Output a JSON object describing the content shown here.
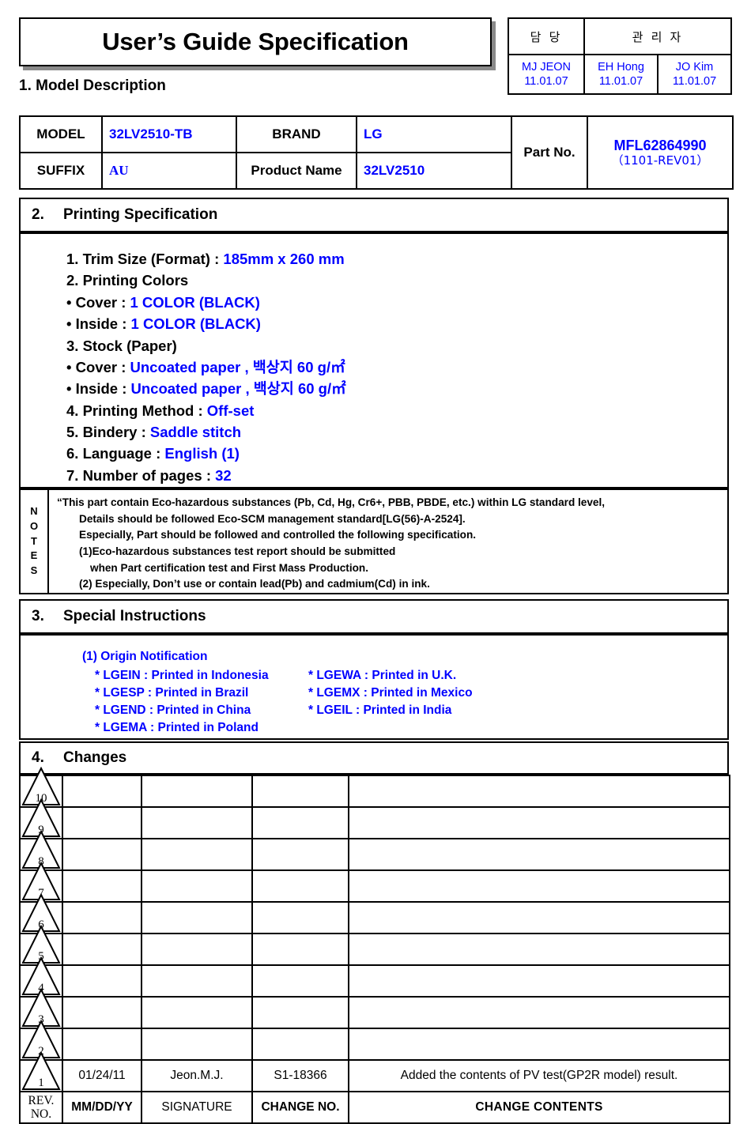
{
  "document": {
    "title": "User’s Guide Specification"
  },
  "approval": {
    "headers": [
      "담  당",
      "관 리 자"
    ],
    "signers": [
      {
        "name": "MJ JEON",
        "date": "11.01.07"
      },
      {
        "name": "EH Hong",
        "date": "11.01.07"
      },
      {
        "name": "JO Kim",
        "date": "11.01.07"
      }
    ]
  },
  "section1": {
    "heading": "1. Model Description",
    "model_label": "MODEL",
    "model_value": "32LV2510-TB",
    "brand_label": "BRAND",
    "brand_value": "LG",
    "suffix_label": "SUFFIX",
    "suffix_value": "AU",
    "product_name_label": "Product Name",
    "product_name_value": "32LV2510",
    "part_no_label": "Part No.",
    "part_no_value": "MFL62864990",
    "part_no_rev": "（1101-REV01）"
  },
  "section2": {
    "number": "2.",
    "heading": "Printing Specification",
    "lines": [
      {
        "label": "1. Trim Size (Format) : ",
        "value": "185mm x 260 mm"
      },
      {
        "label": "2. Printing Colors",
        "value": ""
      },
      {
        "label": "• Cover : ",
        "value": "1 COLOR (BLACK)"
      },
      {
        "label": "• Inside : ",
        "value": "1 COLOR (BLACK)"
      },
      {
        "label": "3. Stock (Paper)",
        "value": ""
      },
      {
        "label": "• Cover : ",
        "value": "Uncoated paper , 백상지 60 g/㎡"
      },
      {
        "label": "• Inside : ",
        "value": "Uncoated paper , 백상지 60 g/㎡"
      },
      {
        "label": "4. Printing Method : ",
        "value": "Off-set"
      },
      {
        "label": "5. Bindery  : ",
        "value": "Saddle stitch"
      },
      {
        "label": "6. Language : ",
        "value": "English (1)"
      },
      {
        "label": "7. Number of pages : ",
        "value": "32"
      }
    ]
  },
  "notes": {
    "label_letters": [
      "N",
      "O",
      "T",
      "E",
      "S"
    ],
    "lines": [
      "“This part contain Eco-hazardous substances (Pb, Cd, Hg, Cr6+, PBB, PBDE, etc.) within LG standard level,",
      "Details should be followed Eco-SCM management standard[LG(56)-A-2524].",
      "Especially, Part should be followed and controlled the following specification.",
      "(1)Eco-hazardous substances test report should be submitted",
      "when  Part certification test and First Mass Production.",
      "(2) Especially, Don’t use or contain lead(Pb) and cadmium(Cd) in ink."
    ]
  },
  "section3": {
    "number": "3.",
    "heading": "Special Instructions",
    "origin_title": "(1) Origin Notification",
    "origin_rows": [
      {
        "left": "* LGEIN : Printed in Indonesia",
        "right": "* LGEWA : Printed in U.K."
      },
      {
        "left": "* LGESP : Printed in Brazil",
        "right": "* LGEMX : Printed in Mexico"
      },
      {
        "left": "* LGEND : Printed in China",
        "right": " * LGEIL : Printed in India"
      },
      {
        "left": "* LGEMA : Printed in Poland",
        "right": ""
      }
    ]
  },
  "section4": {
    "number": "4.",
    "heading": "Changes",
    "rows": [
      {
        "rev": "10",
        "date": "",
        "signature": "",
        "change_no": "",
        "contents": ""
      },
      {
        "rev": "9",
        "date": "",
        "signature": "",
        "change_no": "",
        "contents": ""
      },
      {
        "rev": "8",
        "date": "",
        "signature": "",
        "change_no": "",
        "contents": ""
      },
      {
        "rev": "7",
        "date": "",
        "signature": "",
        "change_no": "",
        "contents": ""
      },
      {
        "rev": "6",
        "date": "",
        "signature": "",
        "change_no": "",
        "contents": ""
      },
      {
        "rev": "5",
        "date": "",
        "signature": "",
        "change_no": "",
        "contents": ""
      },
      {
        "rev": "4",
        "date": "",
        "signature": "",
        "change_no": "",
        "contents": ""
      },
      {
        "rev": "3",
        "date": "",
        "signature": "",
        "change_no": "",
        "contents": ""
      },
      {
        "rev": "2",
        "date": "",
        "signature": "",
        "change_no": "",
        "contents": ""
      },
      {
        "rev": "1",
        "date": "01/24/11",
        "signature": "Jeon.M.J.",
        "change_no": "S1-18366",
        "contents": "Added the  contents of PV test(GP2R model) result."
      }
    ],
    "footer": {
      "rev_line1": "REV.",
      "rev_line2": "NO.",
      "date": "MM/DD/YY",
      "signature": "SIGNATURE",
      "change_no": "CHANGE NO.",
      "contents": "CHANGE   CONTENTS"
    }
  },
  "colors": {
    "accent_blue": "#0000ff",
    "ink_black": "#000000",
    "shadow_gray": "#8a8a8a"
  }
}
